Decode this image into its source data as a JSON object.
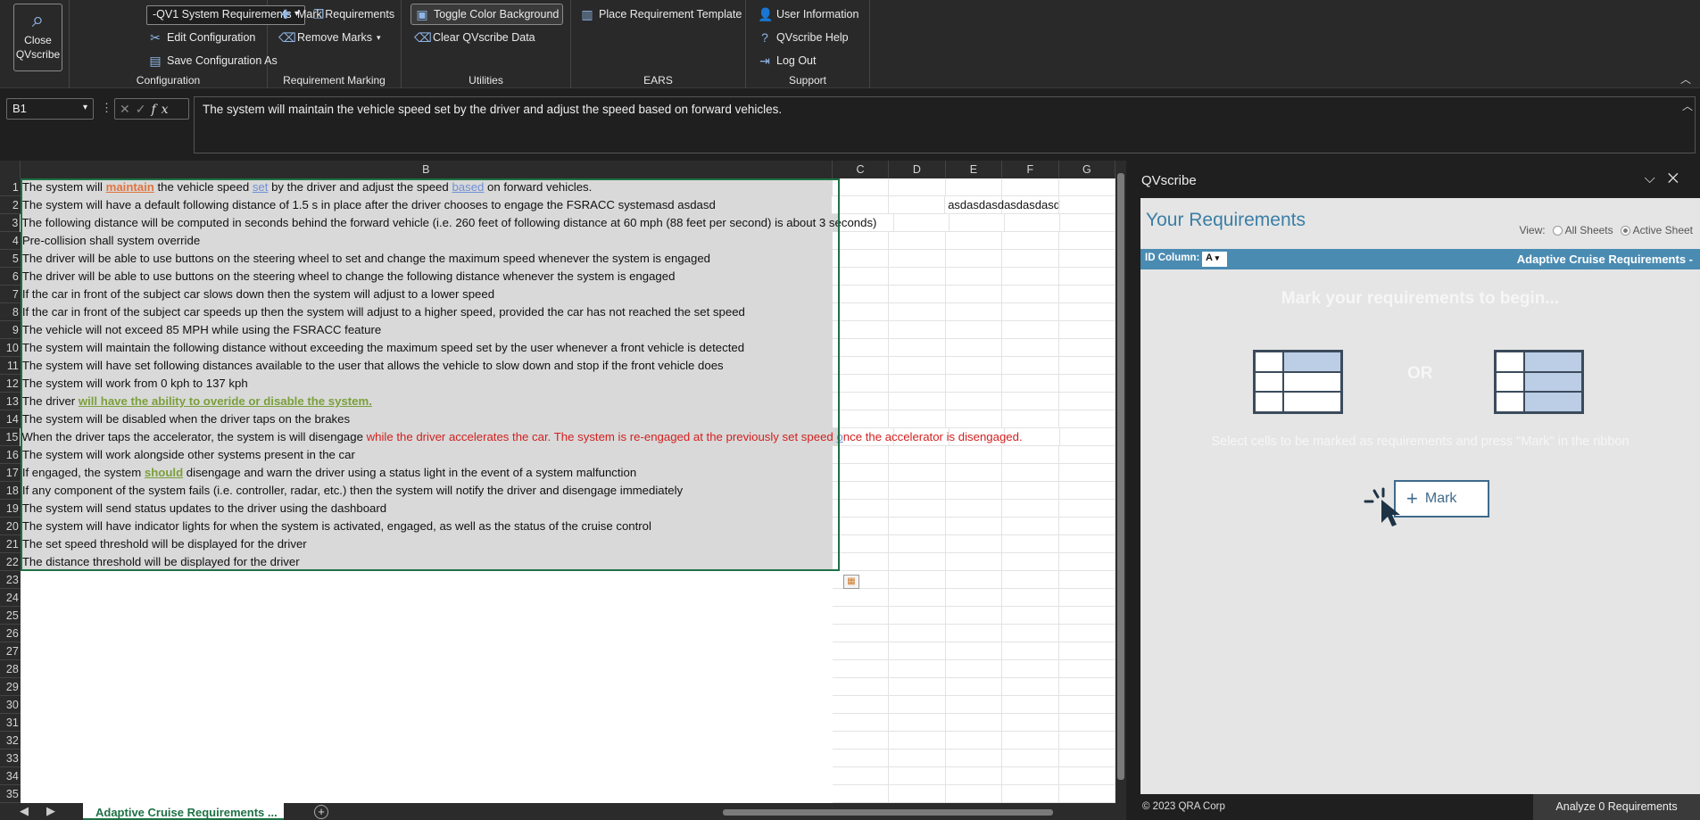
{
  "ribbon": {
    "close_label": "Close QVscribe",
    "config_select": "-QV1 System Requirements",
    "edit_config": "Edit Configuration",
    "save_config_as": "Save Configuration As",
    "group_configuration": "Configuration",
    "mark_requirements": "Mark Requirements",
    "remove_marks": "Remove Marks",
    "group_marking": "Requirement Marking",
    "toggle_bg": "Toggle Color Background",
    "clear_data": "Clear QVscribe Data",
    "group_utilities": "Utilities",
    "place_template": "Place Requirement Template",
    "group_ears": "EARS",
    "user_info": "User Information",
    "help": "QVscribe Help",
    "logout": "Log Out",
    "group_support": "Support"
  },
  "formula": {
    "namebox": "B1",
    "content": "The system will maintain the vehicle speed set by the driver and adjust the speed based on forward vehicles."
  },
  "grid": {
    "columns": [
      "B",
      "C",
      "D",
      "E",
      "F",
      "G"
    ],
    "e2": "asdasdasdasdasdasd",
    "rows": [
      "The system will have a default following distance of 1.5 s in place after the driver chooses to engage the FSRACC systemasd asdasd",
      "The following distance will be computed in seconds behind the forward vehicle (i.e. 260 feet of following distance at 60 mph (88 feet per second) is about 3 seconds)",
      "Pre-collision shall system override",
      "The driver will be able to use buttons on the steering wheel to set and change the maximum speed whenever the system is engaged",
      "The driver will be able to use buttons on the steering wheel to change the following distance whenever the system is engaged",
      "If the car in front of the subject car slows down then the system will adjust to a lower speed",
      "If the car in front of the subject car speeds up then the system will adjust to a higher speed, provided the car has not reached the set speed",
      "The vehicle will not exceed 85 MPH while using the FSRACC feature",
      "The system will maintain the following distance without exceeding the maximum speed set by the user whenever a front vehicle is detected",
      "The system will have set following distances available to the user that allows the vehicle to slow down and stop if the front vehicle does",
      "The system will work from 0 kph to 137 kph",
      "",
      "The system will be disabled when the driver taps on the brakes",
      "",
      "The system will work alongside other systems present in the car",
      "",
      "If any component of the system fails (i.e. controller, radar, etc.) then the system will notify the driver and disengage immediately",
      "The system will send status updates to the driver using the dashboard",
      "The system will have indicator lights for when the system is activated, engaged, as well as the status of the cruise control",
      "The set speed threshold will be displayed for the driver",
      "The distance threshold will be displayed for the driver"
    ],
    "row1": {
      "a": "The system will ",
      "b": "maintain",
      "c": " the vehicle speed ",
      "d": "set",
      "e": " by the driver and adjust the speed ",
      "f": "based",
      "g": " on forward vehicles."
    },
    "row13": {
      "a": "The driver ",
      "b": "will have the ability  to overide or disable the system."
    },
    "row15": {
      "a": "When the driver taps the accelerator, the system is will  disengage ",
      "b": "while the driver accelerates the car. The system is re-engaged at the previously set speed ",
      "c": "o",
      "d": "nce the accelerator is disengaged."
    },
    "row17": {
      "a": "If engaged, the system ",
      "b": "should",
      "c": " disengage and warn the driver using a status light in the event of a system malfunction"
    },
    "sheet_tab": "Adaptive Cruise Requirements ..."
  },
  "panel": {
    "title": "QVscribe",
    "heading": "Your Requirements",
    "view_label": "View:",
    "view_all": "All Sheets",
    "view_active": "Active Sheet",
    "id_column_label": "ID Column:",
    "id_column_value": "A",
    "sheet_name": "Adaptive Cruise Requirements -",
    "mark_msg": "Mark your requirements to begin...",
    "or": "OR",
    "instructions": "Select cells to be marked as requirements and press \"Mark\" in the ribbon",
    "mark_button": "Mark",
    "copyright": "© 2023 QRA Corp",
    "analyze": "Analyze 0 Requirements"
  }
}
